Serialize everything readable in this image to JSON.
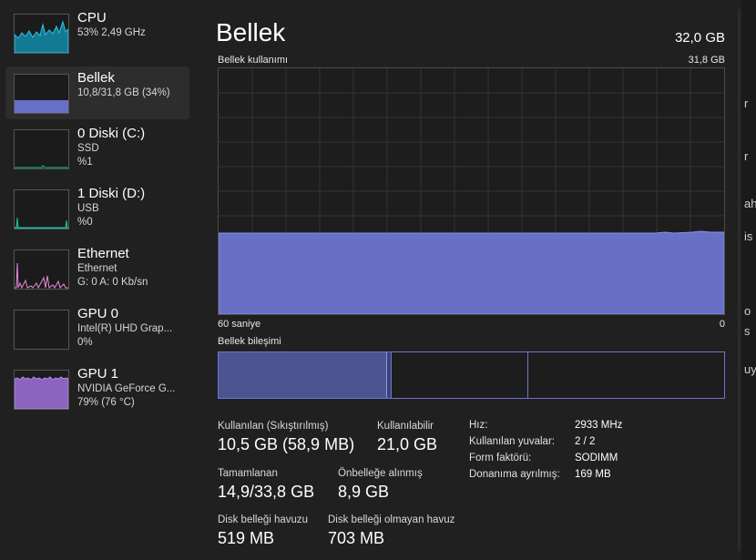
{
  "sidebar": {
    "items": [
      {
        "title": "CPU",
        "sub1": "53%  2,49 GHz",
        "sub2": "",
        "sub3": "",
        "color": "#17a3c4"
      },
      {
        "title": "Bellek",
        "sub1": "10,8/31,8 GB (34%)",
        "sub2": "",
        "sub3": "",
        "color": "#7a84e6"
      },
      {
        "title": "0 Diski (C:)",
        "sub1": "SSD",
        "sub2": "%1",
        "sub3": "",
        "color": "#1fbf9f"
      },
      {
        "title": "1 Diski (D:)",
        "sub1": "USB",
        "sub2": "%0",
        "sub3": "",
        "color": "#1fbf9f"
      },
      {
        "title": "Ethernet",
        "sub1": "Ethernet",
        "sub2": "G: 0 A: 0 Kb/sn",
        "sub3": "",
        "color": "#e07ad6"
      },
      {
        "title": "GPU 0",
        "sub1": "Intel(R) UHD Grap...",
        "sub2": "0%",
        "sub3": "",
        "color": "#9a6ad0"
      },
      {
        "title": "GPU 1",
        "sub1": "NVIDIA GeForce G...",
        "sub2": "79% (76 °C)",
        "sub3": "",
        "color": "#9a6ad0"
      }
    ]
  },
  "main": {
    "title": "Bellek",
    "total": "32,0 GB",
    "usage_label": "Bellek kullanımı",
    "usage_max": "31,8 GB",
    "time_left": "60 saniye",
    "time_right": "0",
    "composition_label": "Bellek bileşimi",
    "usage_fraction": 0.34
  },
  "stats": {
    "in_use": {
      "label": "Kullanılan (Sıkıştırılmış)",
      "value": "10,5 GB (58,9 MB)"
    },
    "available": {
      "label": "Kullanılabilir",
      "value": "21,0 GB"
    },
    "committed": {
      "label": "Tamamlanan",
      "value": "14,9/33,8 GB"
    },
    "cached": {
      "label": "Önbelleğe alınmış",
      "value": "8,9 GB"
    },
    "paged": {
      "label": "Disk belleği havuzu",
      "value": "519 MB"
    },
    "nonpaged": {
      "label": "Disk belleği olmayan havuz",
      "value": "703 MB"
    }
  },
  "properties": [
    {
      "key": "Hız:",
      "value": "2933 MHz"
    },
    {
      "key": "Kullanılan yuvalar:",
      "value": "2 / 2"
    },
    {
      "key": "Form faktörü:",
      "value": "SODIMM"
    },
    {
      "key": "Donanıma ayrılmış:",
      "value": "169 MB"
    }
  ],
  "edge_fragments": [
    "r",
    "ah",
    "is",
    "o",
    "s",
    "uy"
  ],
  "colors": {
    "accent": "#6c74d4",
    "fill": "#6870c6"
  }
}
